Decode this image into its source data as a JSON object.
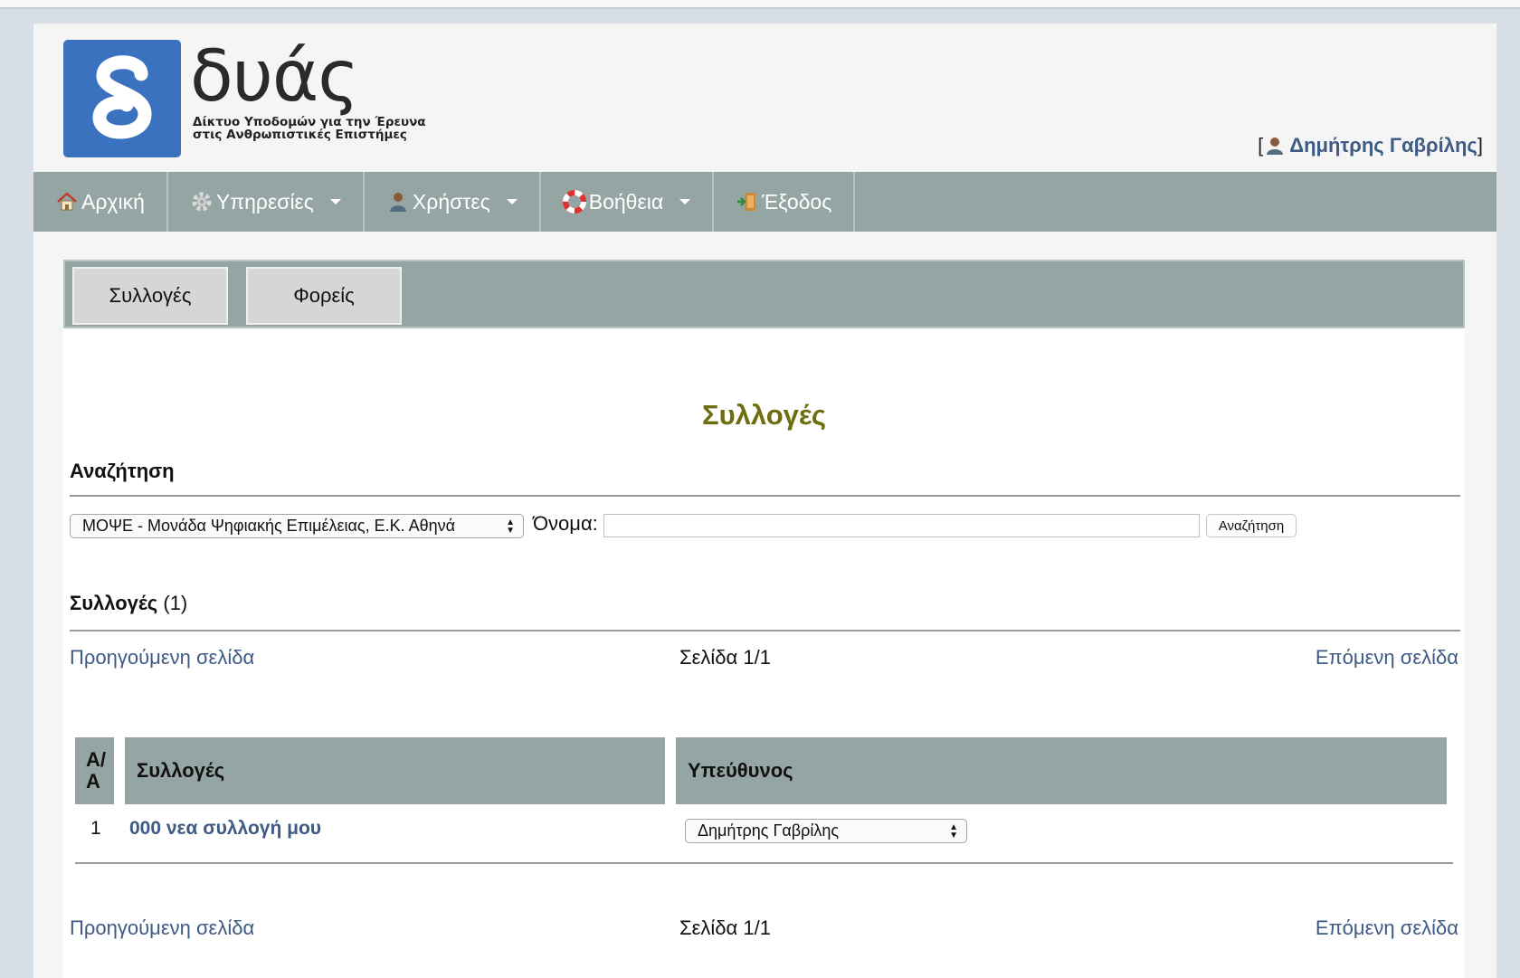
{
  "header": {
    "brand": "δυάς",
    "brand_sub_line1": "Δίκτυο Υποδομών για την Έρευνα",
    "brand_sub_line2": "στις Ανθρωπιστικές Επιστήμες",
    "user_name": "Δημήτρης Γαβρίλης",
    "bracket_open": "[",
    "bracket_close": "]",
    "user_icon": "user-icon"
  },
  "nav": {
    "items": [
      {
        "label": "Αρχική",
        "icon": "home-icon"
      },
      {
        "label": "Υπηρεσίες",
        "icon": "gear-icon",
        "dropdown": true
      },
      {
        "label": "Χρήστες",
        "icon": "user-icon",
        "dropdown": true
      },
      {
        "label": "Βοήθεια",
        "icon": "lifebuoy-icon",
        "dropdown": true
      },
      {
        "label": "Έξοδος",
        "icon": "exit-door-icon"
      }
    ]
  },
  "subnav": {
    "tabs": [
      {
        "label": "Συλλογές"
      },
      {
        "label": "Φορείς"
      }
    ]
  },
  "main": {
    "title": "Συλλογές",
    "search": {
      "heading": "Αναζήτηση",
      "org_select_value": "ΜΟΨΕ - Μονάδα Ψηφιακής Επιμέλειας, Ε.Κ. Αθηνά",
      "name_label": "Όνομα:",
      "name_value": "",
      "button_label": "Αναζήτηση"
    },
    "results": {
      "heading": "Συλλογές",
      "count_text": "(1)"
    },
    "pager": {
      "prev": "Προηγούμενη σελίδα",
      "page": "Σελίδα 1/1",
      "next": "Επόμενη σελίδα"
    },
    "table": {
      "headers": {
        "aa_line1": "Α/",
        "aa_line2": "Α",
        "collections": "Συλλογές",
        "owner": "Υπεύθυνος"
      },
      "rows": [
        {
          "num": "1",
          "name": "000 νεα συλλογή μου",
          "owner": "Δημήτρης Γαβρίλης"
        }
      ]
    }
  },
  "colors": {
    "nav_bg": "#95a5a3",
    "logo_bg": "#3b72c0",
    "title_color": "#6e6e11",
    "link_color": "#3e5a85"
  }
}
